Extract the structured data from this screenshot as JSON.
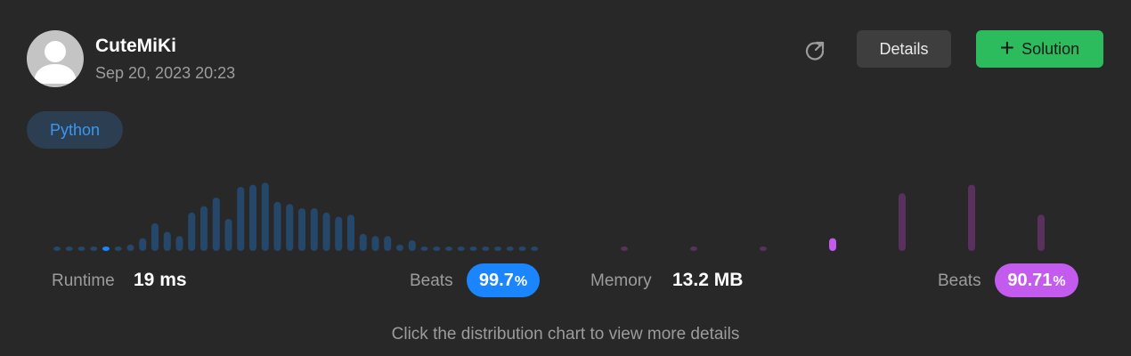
{
  "user": {
    "name": "CuteMiKi",
    "timestamp": "Sep 20, 2023 20:23"
  },
  "buttons": {
    "details_label": "Details",
    "solution_plus": "+",
    "solution_label": "Solution"
  },
  "language_tag": "Python",
  "runtime": {
    "label": "Runtime",
    "value": "19 ms",
    "beats_label": "Beats",
    "beats_value": "99.7",
    "beats_unit": "%"
  },
  "memory": {
    "label": "Memory",
    "value": "13.2 MB",
    "beats_label": "Beats",
    "beats_value": "90.71",
    "beats_unit": "%"
  },
  "hint": "Click the distribution chart to view more details",
  "colors": {
    "runtime_bar": "#25476a",
    "runtime_highlight": "#1a85ff",
    "runtime_pill": "#1a85ff",
    "memory_bar": "#59305e",
    "memory_highlight": "#c35bef",
    "memory_pill": "#c35bef",
    "accept_green": "#2cbb5d"
  },
  "icons": {
    "avatar": "user-silhouette",
    "refresh": "refresh-icon",
    "plus": "plus-icon"
  },
  "chart_data": [
    {
      "type": "bar",
      "name": "runtime-distribution",
      "relative_values": [
        1,
        1,
        1,
        1,
        1,
        2,
        3,
        6,
        13,
        9,
        7,
        18,
        21,
        25,
        15,
        30,
        31,
        32,
        23,
        22,
        20,
        20,
        18,
        16,
        17,
        8,
        7,
        7,
        3,
        5,
        2,
        2,
        2,
        2,
        2,
        2,
        2,
        2,
        2,
        2
      ],
      "highlight_index": 4
    },
    {
      "type": "bar",
      "name": "memory-distribution",
      "relative_values": [
        2,
        2,
        2,
        6,
        27,
        31,
        17
      ],
      "highlight_index": 3
    }
  ]
}
